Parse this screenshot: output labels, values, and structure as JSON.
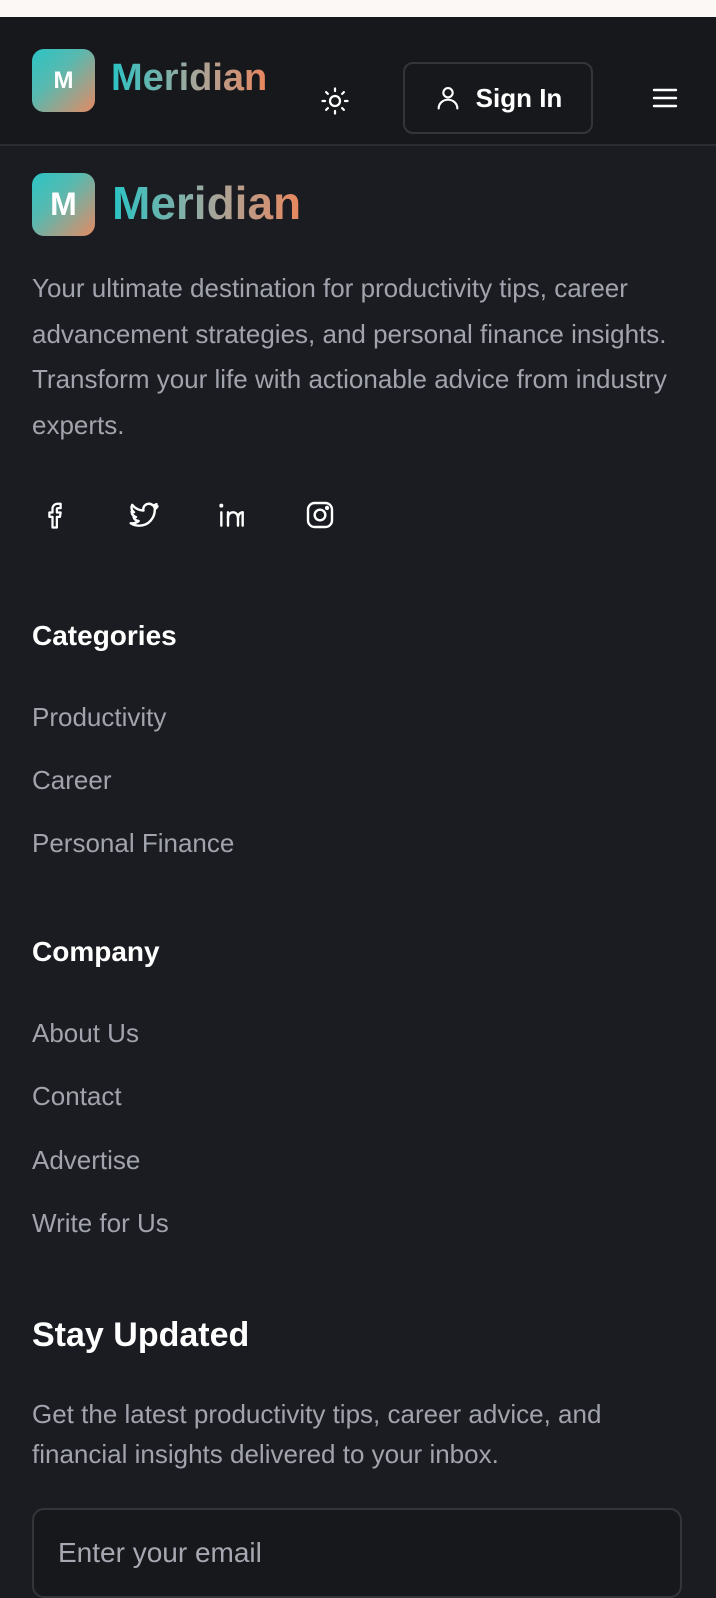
{
  "header": {
    "logo_letter": "M",
    "brand": "Meridian",
    "signin_label": "Sign In",
    "icons": {
      "theme": "sun-icon",
      "user": "user-icon",
      "menu": "menu-icon"
    }
  },
  "footer": {
    "logo_letter": "M",
    "brand": "Meridian",
    "description": "Your ultimate destination for productivity tips, career advancement strategies, and personal finance insights. Transform your life with actionable advice from industry experts.",
    "social": [
      "facebook-icon",
      "twitter-icon",
      "linkedin-icon",
      "instagram-icon"
    ],
    "categories": {
      "title": "Categories",
      "links": [
        "Productivity",
        "Career",
        "Personal Finance"
      ]
    },
    "company": {
      "title": "Company",
      "links": [
        "About Us",
        "Contact",
        "Advertise",
        "Write for Us"
      ]
    },
    "newsletter": {
      "title": "Stay Updated",
      "description": "Get the latest productivity tips, career advice, and financial insights delivered to your inbox.",
      "email_placeholder": "Enter your email",
      "email_value": ""
    }
  },
  "colors": {
    "background": "#1b1c21",
    "header_background": "#17181c",
    "muted_text": "#a1a3ad",
    "brand_start": "#2bc4c4",
    "brand_end": "#e8875e"
  }
}
